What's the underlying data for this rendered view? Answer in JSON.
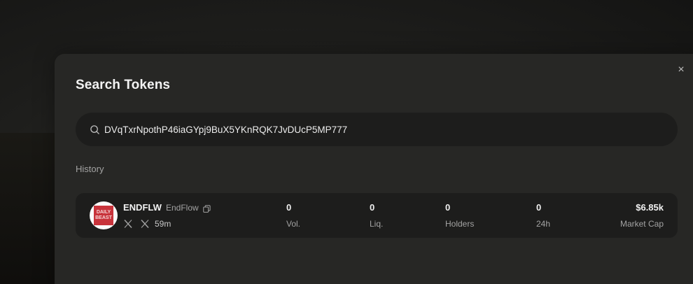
{
  "modal": {
    "title": "Search Tokens",
    "close_glyph": "×"
  },
  "search": {
    "value": "DVqTxrNpothP46iaGYpj9BuX5YKnRQK7JvDUcP5MP777",
    "icon": "search-icon"
  },
  "history": {
    "label": "History",
    "items": [
      {
        "avatar_text": "DAILY BEAST",
        "symbol": "ENDFLW",
        "name": "EndFlow",
        "age": "59m",
        "stats": [
          {
            "value": "0",
            "label": "Vol."
          },
          {
            "value": "0",
            "label": "Liq."
          },
          {
            "value": "0",
            "label": "Holders"
          },
          {
            "value": "0",
            "label": "24h"
          },
          {
            "value": "$6.85k",
            "label": "Market Cap"
          }
        ]
      }
    ]
  },
  "colors": {
    "modal_bg": "#272725",
    "field_bg": "#1d1d1c",
    "avatar_brand": "#c8333b"
  }
}
